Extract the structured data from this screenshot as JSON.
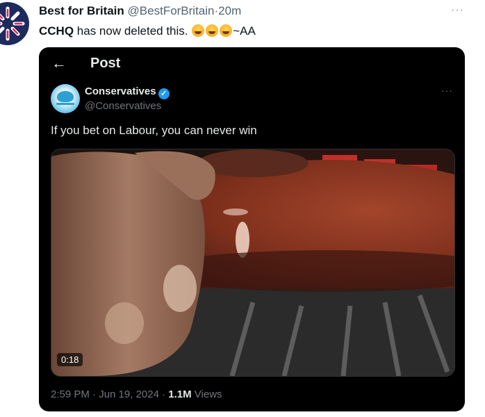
{
  "outer": {
    "author_name": "Best for Britain",
    "author_handle": "@BestForBritain",
    "separator": "·",
    "time_ago": "20m",
    "more": "···",
    "text_bold": "CCHQ",
    "text_rest": " has now deleted this. ",
    "text_suffix": "~AA",
    "emojis": [
      "face-with-tears-of-joy",
      "rolling-on-floor-laughing",
      "face-with-tears-of-joy"
    ]
  },
  "screenshot": {
    "back_icon": "←",
    "title": "Post",
    "author_name": "Conservatives",
    "verified_icon": "✓",
    "author_handle": "@Conservatives",
    "more": "···",
    "text": "If you bet on Labour, you can never win",
    "video_duration": "0:18",
    "timestamp": "2:59 PM · Jun 19, 2024 · ",
    "views_count": "1.1M",
    "views_label": " Views"
  },
  "colors": {
    "link_blue": "#1d9bf0",
    "muted": "#536471",
    "dark_bg": "#000000"
  }
}
